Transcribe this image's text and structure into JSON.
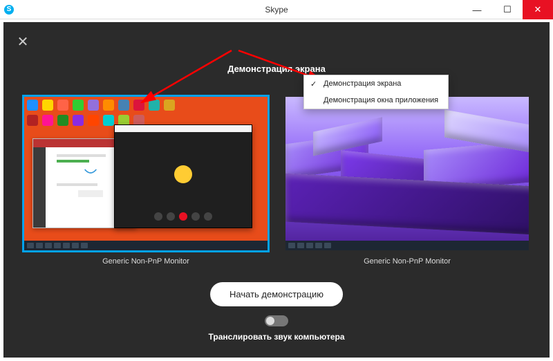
{
  "window": {
    "app_name": "Skype",
    "title": "Skype"
  },
  "dialog": {
    "heading": "Демонстрация экрана",
    "monitors": [
      {
        "label": "Generic Non-PnP Monitor",
        "selected": true
      },
      {
        "label": "Generic Non-PnP Monitor",
        "selected": false
      }
    ],
    "dropdown": {
      "items": [
        {
          "label": "Демонстрация экрана",
          "selected": true
        },
        {
          "label": "Демонстрация окна приложения",
          "selected": false
        }
      ]
    },
    "start_button": "Начать демонстрацию",
    "audio_toggle": {
      "label": "Транслировать звук компьютера",
      "enabled": false
    }
  },
  "colors": {
    "accent": "#00a2ed",
    "close": "#e81123",
    "panel": "#2b2b2b"
  }
}
